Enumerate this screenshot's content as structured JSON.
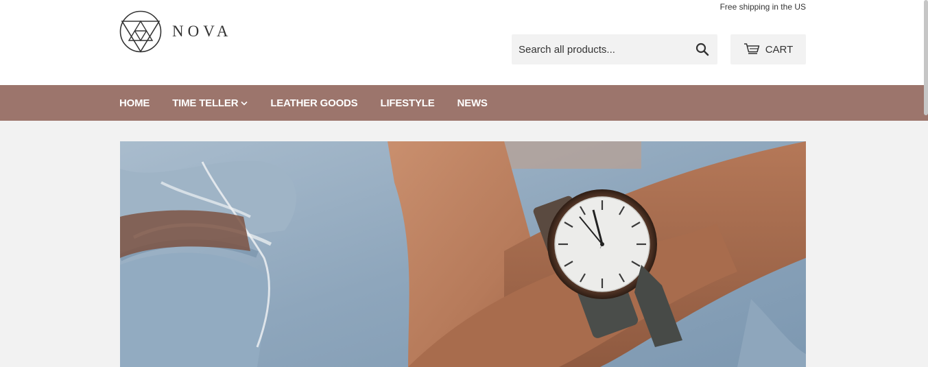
{
  "header": {
    "promo_text": "Free shipping in the US",
    "logo_text": "NOVA",
    "logo_icon": "triangle-circle-logo-icon"
  },
  "search": {
    "placeholder": "Search all products...",
    "icon": "search-icon"
  },
  "cart": {
    "label": "CART",
    "icon": "cart-icon"
  },
  "nav": {
    "items": [
      {
        "label": "HOME"
      },
      {
        "label": "TIME TELLER",
        "has_dropdown": true
      },
      {
        "label": "LEATHER GOODS"
      },
      {
        "label": "LIFESTYLE"
      },
      {
        "label": "NEWS"
      }
    ]
  },
  "colors": {
    "nav_background": "#9c756c",
    "page_background": "#f2f2f2",
    "text": "#333333"
  }
}
